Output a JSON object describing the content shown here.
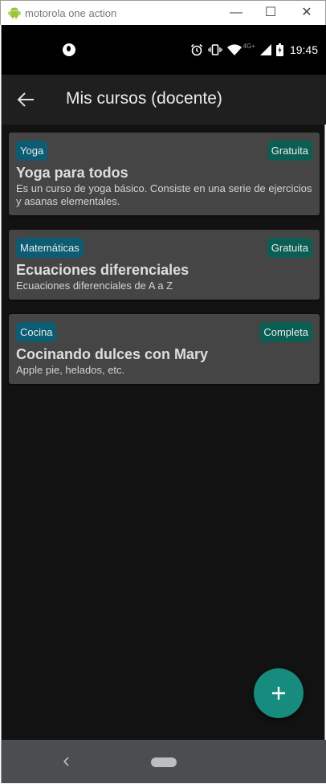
{
  "window": {
    "title": "motorola one action",
    "minimize_glyph": "—",
    "maximize_glyph": "☐",
    "close_glyph": "✕"
  },
  "status_bar": {
    "network_label": "4G+",
    "time": "19:45",
    "icons": [
      "notification-icon",
      "alarm-icon",
      "vibrate-icon",
      "wifi-icon",
      "signal-icon",
      "battery-icon"
    ]
  },
  "app_bar": {
    "title": "Mis cursos (docente)",
    "back_icon": "arrow-back-icon"
  },
  "courses": [
    {
      "category": "Yoga",
      "type": "Gratuita",
      "title": "Yoga para todos",
      "description": "Es un curso de yoga básico. Consiste en una serie de ejercicios y asanas elementales."
    },
    {
      "category": "Matemáticas",
      "type": "Gratuita",
      "title": "Ecuaciones diferenciales",
      "description": "Ecuaciones diferenciales de A a Z"
    },
    {
      "category": "Cocina",
      "type": "Completa",
      "title": "Cocinando dulces con Mary",
      "description": "Apple pie, helados, etc."
    }
  ],
  "fab": {
    "icon": "plus-icon"
  },
  "nav_bar": {
    "back_icon": "nav-back-icon",
    "home_icon": "nav-home-icon"
  },
  "colors": {
    "background": "#121212",
    "card": "#454545",
    "category_chip": "#0c5c73",
    "type_chip": "#0b5e52",
    "fab": "#168b7e"
  }
}
